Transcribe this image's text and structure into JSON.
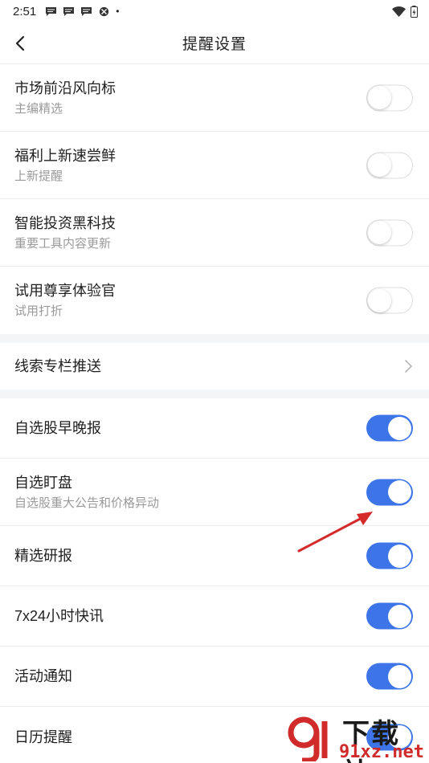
{
  "status_bar": {
    "time": "2:51",
    "dot": "•",
    "icons": [
      "message-icon",
      "message-icon",
      "message-icon",
      "ball-icon",
      "wifi-icon",
      "battery-icon"
    ]
  },
  "header": {
    "title": "提醒设置",
    "back_icon": "back-arrow-icon"
  },
  "group1": [
    {
      "title": "市场前沿风向标",
      "subtitle": "主编精选",
      "enabled": false
    },
    {
      "title": "福利上新速尝鲜",
      "subtitle": "上新提醒",
      "enabled": false
    },
    {
      "title": "智能投资黑科技",
      "subtitle": "重要工具内容更新",
      "enabled": false
    },
    {
      "title": "试用尊享体验官",
      "subtitle": "试用打折",
      "enabled": false
    }
  ],
  "group2": {
    "title": "线索专栏推送",
    "icon": "chevron-right-icon"
  },
  "group3": [
    {
      "title": "自选股早晚报",
      "enabled": true
    },
    {
      "title": "自选盯盘",
      "subtitle": "自选股重大公告和价格异动",
      "enabled": true
    },
    {
      "title": "精选研报",
      "enabled": true
    },
    {
      "title": "7x24小时快讯",
      "enabled": true
    },
    {
      "title": "活动通知",
      "enabled": true
    },
    {
      "title": "日历提醒",
      "enabled": true
    }
  ],
  "watermark": {
    "text": "下载站",
    "domain": "91xz.net"
  },
  "colors": {
    "toggle_on": "#3d75e8",
    "annotation_arrow": "#d42a2a"
  }
}
